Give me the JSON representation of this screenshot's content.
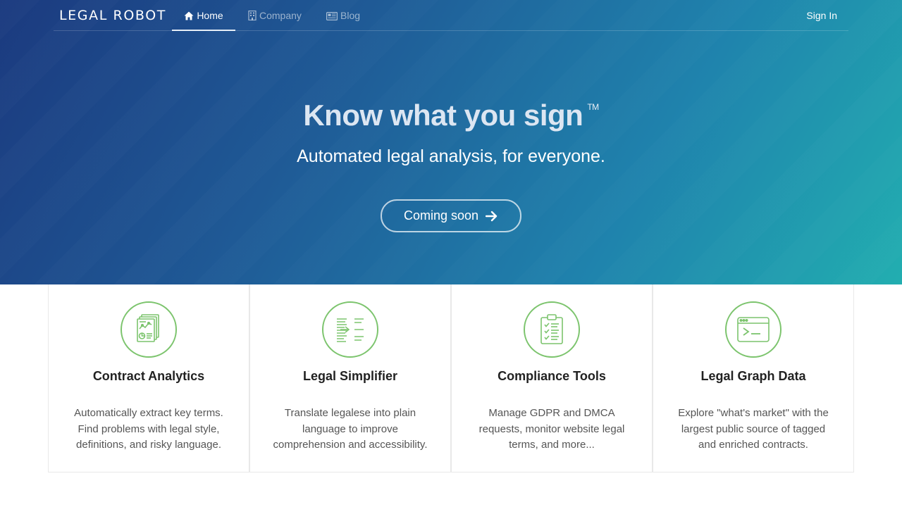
{
  "nav": {
    "logo": "LEGAL ROBOT",
    "items": [
      {
        "label": "Home",
        "icon": "home-icon",
        "active": true
      },
      {
        "label": "Company",
        "icon": "building-icon",
        "active": false
      },
      {
        "label": "Blog",
        "icon": "newspaper-icon",
        "active": false
      }
    ],
    "sign_in": "Sign In"
  },
  "hero": {
    "headline": "Know what you sign",
    "trademark": "TM",
    "subheadline": "Automated legal analysis, for everyone.",
    "cta_label": "Coming soon",
    "cta_icon": "arrow-right-icon"
  },
  "features": [
    {
      "icon": "contract-analytics-icon",
      "title": "Contract Analytics",
      "description": "Automatically extract key terms. Find problems with legal style, definitions, and risky language."
    },
    {
      "icon": "legal-simplifier-icon",
      "title": "Legal Simplifier",
      "description": "Translate legalese into plain language to improve comprehension and accessibility."
    },
    {
      "icon": "compliance-clipboard-icon",
      "title": "Compliance Tools",
      "description": "Manage GDPR and DMCA requests, monitor website legal terms, and more..."
    },
    {
      "icon": "terminal-window-icon",
      "title": "Legal Graph Data",
      "description": "Explore \"what's market\" with the largest public source of tagged and enriched contracts."
    }
  ],
  "colors": {
    "accent_green": "#7cc46d",
    "hero_gradient_start": "#1b3a7f",
    "hero_gradient_end": "#22aeb0"
  }
}
